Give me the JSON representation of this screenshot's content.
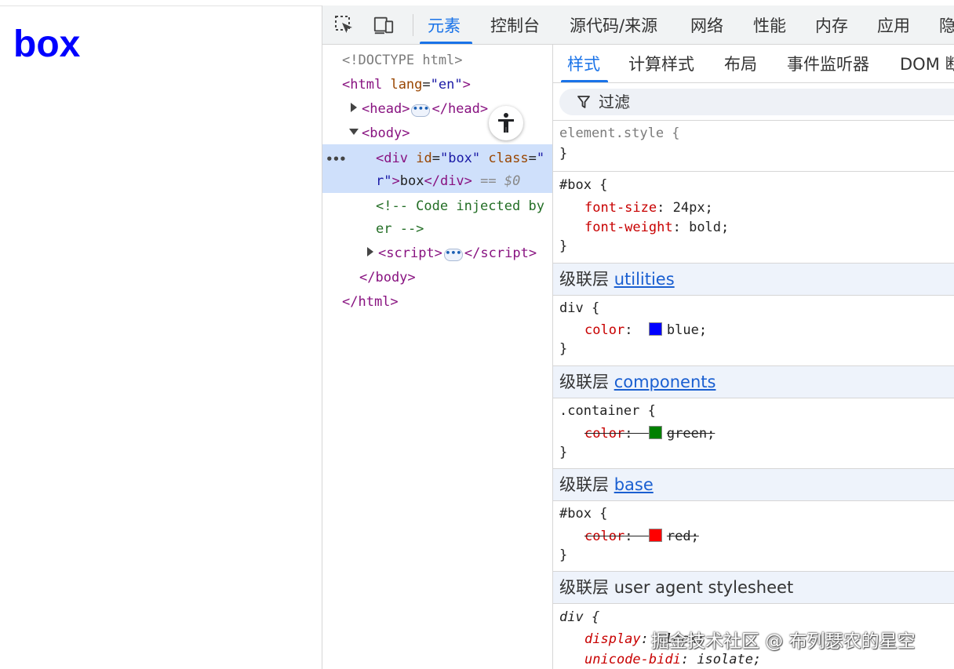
{
  "page": {
    "heading": "box"
  },
  "toolbar": {
    "tabs": [
      {
        "label": "元素",
        "active": true
      },
      {
        "label": "控制台"
      },
      {
        "label": "源代码/来源"
      },
      {
        "label": "网络"
      },
      {
        "label": "性能"
      },
      {
        "label": "内存"
      },
      {
        "label": "应用"
      },
      {
        "label": "隐"
      }
    ]
  },
  "dom": {
    "doctype": "<!DOCTYPE html>",
    "html_open_tag": "html",
    "html_lang_attr": "lang",
    "html_lang_value": "en",
    "head_tag": "head",
    "body_tag": "body",
    "div_tag": "div",
    "div_id_attr": "id",
    "div_id_value": "box",
    "div_class_attr": "class",
    "div_line2_prefix": "r",
    "div_text": "box",
    "selected_marker": "== $0",
    "comment_line1": "<!-- Code injected by",
    "comment_line2": "er -->",
    "script_tag": "script",
    "body_close": "</body>",
    "html_close": "</html>"
  },
  "styles": {
    "sub_tabs": [
      "样式",
      "计算样式",
      "布局",
      "事件监听器",
      "DOM 断"
    ],
    "filter_placeholder": "过滤",
    "rules": {
      "element_style": {
        "selector": "element.style {",
        "close": "}"
      },
      "box_inline": {
        "selector": "#box {",
        "decls": [
          {
            "prop": "font-size",
            "value": "24px;"
          },
          {
            "prop": "font-weight",
            "value": "bold;"
          }
        ],
        "close": "}"
      },
      "utilities": {
        "layer_prefix": "级联层",
        "layer_name": "utilities",
        "selector": "div {",
        "prop": "color",
        "value": "blue;",
        "swatch": "#0000ff",
        "close": "}"
      },
      "components": {
        "layer_prefix": "级联层",
        "layer_name": "components",
        "selector": ".container {",
        "prop": "color",
        "value": "green;",
        "swatch": "#008000",
        "close": "}"
      },
      "base": {
        "layer_prefix": "级联层",
        "layer_name": "base",
        "selector": "#box {",
        "prop": "color",
        "value": "red;",
        "swatch": "#ff0000",
        "close": "}"
      },
      "user_agent": {
        "layer_prefix": "级联层",
        "layer_name": "user agent stylesheet",
        "selector": "div {",
        "decls": [
          {
            "prop": "display",
            "value": "block;"
          },
          {
            "prop": "unicode-bidi",
            "value": "isolate;"
          }
        ]
      }
    }
  },
  "watermark": "掘金技术社区 @ 布列瑟农的星空",
  "colors": {
    "accent": "#1a73e8",
    "selected_row": "#cfe0fb",
    "layer_header": "#eef3fb"
  }
}
